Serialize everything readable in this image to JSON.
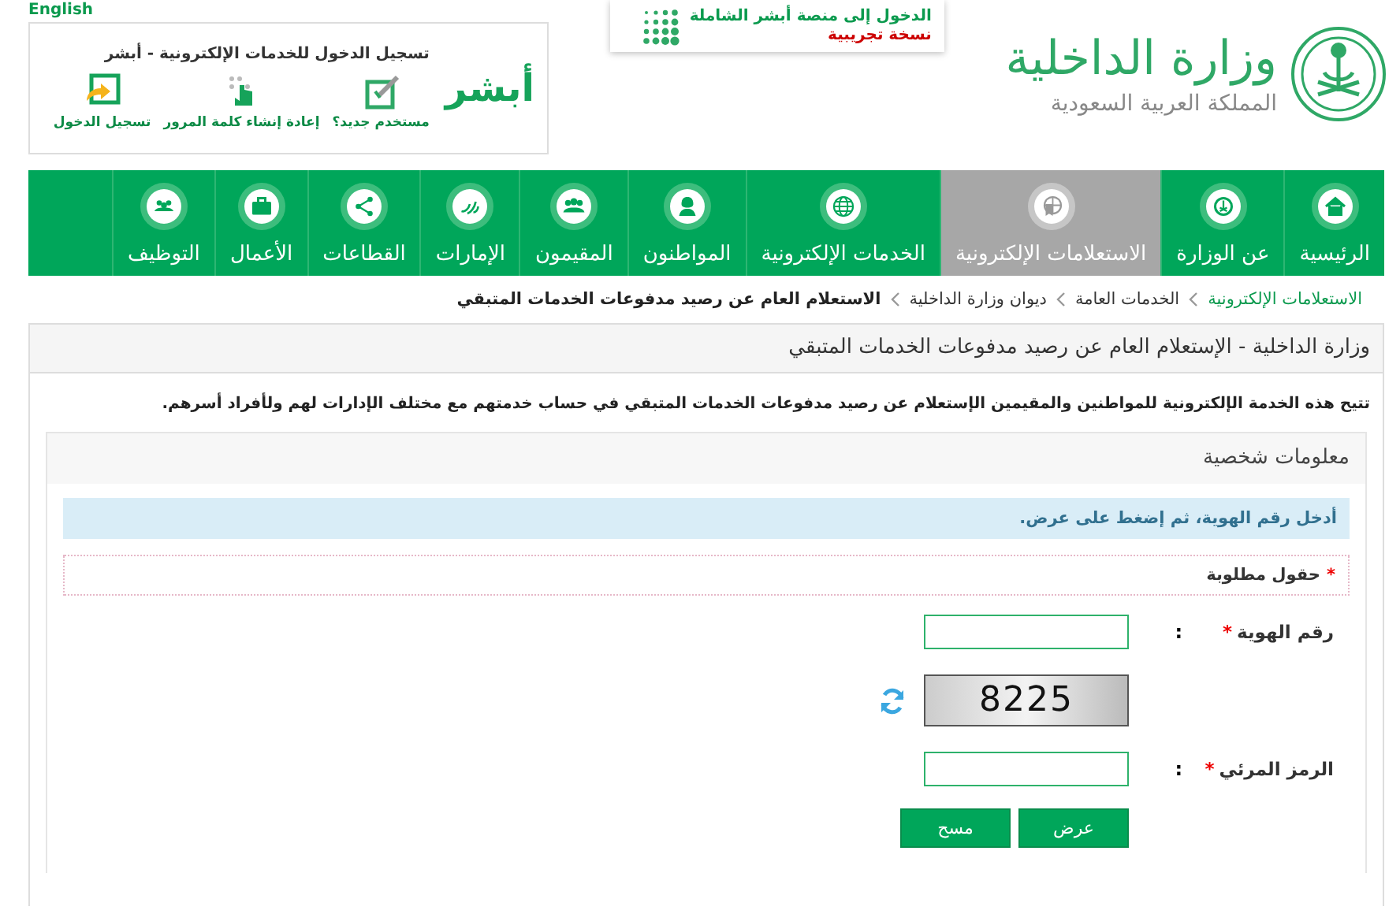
{
  "top_bar": {
    "language_link": "English"
  },
  "logo": {
    "title": "وزارة الداخلية",
    "subtitle": "المملكة العربية السعودية"
  },
  "banner": {
    "title": "الدخول إلى منصة أبشر الشاملة",
    "note": "نسخة تجريبية"
  },
  "login_box": {
    "title": "تسجيل الدخول للخدمات الإلكترونية - أبشر",
    "brand": "أبشر",
    "links": [
      "مستخدم جديد؟",
      "إعادة إنشاء كلمة المرور",
      "تسجيل الدخول"
    ]
  },
  "nav": [
    {
      "label": "الرئيسية",
      "selected": false
    },
    {
      "label": "عن الوزارة",
      "selected": false
    },
    {
      "label": "الاستعلامات الإلكترونية",
      "selected": true
    },
    {
      "label": "الخدمات الإلكترونية",
      "selected": false
    },
    {
      "label": "المواطنون",
      "selected": false
    },
    {
      "label": "المقيمون",
      "selected": false
    },
    {
      "label": "الإمارات",
      "selected": false
    },
    {
      "label": "القطاعات",
      "selected": false
    },
    {
      "label": "الأعمال",
      "selected": false
    },
    {
      "label": "التوظيف",
      "selected": false
    }
  ],
  "breadcrumb": [
    {
      "label": "الاستعلامات الإلكترونية",
      "kind": "link"
    },
    {
      "label": "الخدمات العامة",
      "kind": "link"
    },
    {
      "label": "ديوان وزارة الداخلية",
      "kind": "link"
    },
    {
      "label": "الاستعلام العام عن رصيد مدفوعات الخدمات المتبقي",
      "kind": "current"
    }
  ],
  "page": {
    "title": "وزارة الداخلية - الإستعلام العام عن رصيد مدفوعات الخدمات المتبقي",
    "description": "تتيح هذه الخدمة الإلكترونية للمواطنين والمقيمين الإستعلام عن رصيد مدفوعات الخدمات المتبقي في حساب خدمتهم مع مختلف الإدارات لهم ولأفراد أسرهم.",
    "section_title": "معلومات شخصية",
    "info": "أدخل رقم الهوية، ثم إضغط على عرض.",
    "required_note": {
      "mark": "*",
      "text": "حقول مطلوبة"
    },
    "fields": [
      {
        "kind": "input",
        "label": "رقم الهوية",
        "mark": "*",
        "colon": ":"
      },
      {
        "kind": "captcha",
        "code": "8225"
      },
      {
        "kind": "input",
        "label": "الرمز المرئي",
        "mark": "*",
        "colon": ":"
      }
    ],
    "buttons": [
      "عرض",
      "مسح"
    ]
  }
}
